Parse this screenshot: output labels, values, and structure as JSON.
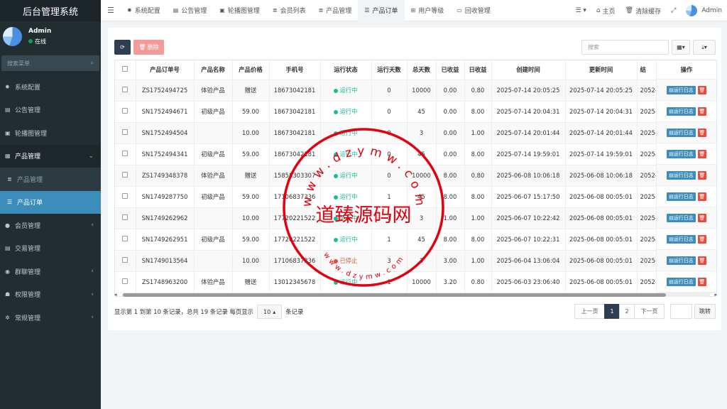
{
  "app": {
    "title": "后台管理系统"
  },
  "user": {
    "name": "Admin",
    "status": "在线"
  },
  "sidebar": {
    "search_placeholder": "搜索菜单",
    "items": [
      {
        "label": "系统配置",
        "icon": "gear-icon"
      },
      {
        "label": "公告管理",
        "icon": "file-icon"
      },
      {
        "label": "轮播图管理",
        "icon": "image-icon"
      },
      {
        "label": "产品管理",
        "icon": "grid-icon"
      },
      {
        "label": "产品管理",
        "icon": "list-icon"
      },
      {
        "label": "产品订单",
        "icon": "menu-icon"
      },
      {
        "label": "会员管理",
        "icon": "user-icon"
      },
      {
        "label": "交易管理",
        "icon": "list-icon"
      },
      {
        "label": "群聊管理",
        "icon": "chat-icon"
      },
      {
        "label": "权限管理",
        "icon": "group-icon"
      },
      {
        "label": "常规管理",
        "icon": "cogs-icon"
      }
    ]
  },
  "topbar": {
    "tabs": [
      {
        "label": "系统配置"
      },
      {
        "label": "公告管理"
      },
      {
        "label": "轮播图管理"
      },
      {
        "label": "会员列表"
      },
      {
        "label": "产品管理"
      },
      {
        "label": "产品订单"
      },
      {
        "label": "用户等级"
      },
      {
        "label": "回收管理"
      }
    ],
    "home": "主页",
    "clear_cache": "清除缓存",
    "user": "Admin"
  },
  "toolbar": {
    "delete_label": "删除",
    "search_placeholder": "搜索"
  },
  "table": {
    "headers": [
      "产品订单号",
      "产品名称",
      "产品价格",
      "手机号",
      "运行状态",
      "运行天数",
      "总天数",
      "已收益",
      "日收益",
      "创建时间",
      "更新时间",
      "结"
    ],
    "op_header": "操作",
    "op_log_label": "运行日志",
    "rows": [
      [
        "ZS1752494725",
        "体验产品",
        "赠送",
        "18673042181",
        "运行中",
        "0",
        "10000",
        "0.00",
        "0.80",
        "2025-07-14 20:05:25",
        "2025-07-14 20:05:25",
        "2052-1"
      ],
      [
        "SN1752494671",
        "初级产品",
        "59.00",
        "18673042181",
        "运行中",
        "0",
        "45",
        "0.00",
        "8.00",
        "2025-07-14 20:04:31",
        "2025-07-14 20:04:31",
        "2025-0"
      ],
      [
        "SN1752494504",
        "",
        "10.00",
        "18673042181",
        "运行中",
        "0",
        "3",
        "0.00",
        "1.00",
        "2025-07-14 20:01:44",
        "2025-07-14 20:01:44",
        "2025-0"
      ],
      [
        "SN1752494341",
        "初级产品",
        "59.00",
        "18673042181",
        "运行中",
        "0",
        "45",
        "0.00",
        "8.00",
        "2025-07-14 19:59:01",
        "2025-07-14 19:59:01",
        "2025-0"
      ],
      [
        "ZS1749348378",
        "体验产品",
        "赠送",
        "15858303307",
        "运行中",
        "0",
        "10000",
        "8.00",
        "0.80",
        "2025-06-08 10:06:18",
        "2025-06-08 10:06:18",
        "2052-1"
      ],
      [
        "SN1749287750",
        "初级产品",
        "59.00",
        "17106837336",
        "运行中",
        "1",
        "45",
        "8.00",
        "8.00",
        "2025-06-07 15:17:50",
        "2025-06-08 00:05:01",
        "2025-0"
      ],
      [
        "SN1749262962",
        "",
        "10.00",
        "17720221522",
        "运行中",
        "1",
        "3",
        "1.00",
        "1.00",
        "2025-06-07 10:22:42",
        "2025-06-08 00:05:01",
        "2025-0"
      ],
      [
        "SN1749262951",
        "初级产品",
        "59.00",
        "17720221522",
        "运行中",
        "1",
        "45",
        "8.00",
        "8.00",
        "2025-06-07 10:22:31",
        "2025-06-08 00:05:01",
        "2025-0"
      ],
      [
        "SN1749013564",
        "",
        "10.00",
        "17106837336",
        "已停止",
        "3",
        "3",
        "3.00",
        "1.00",
        "2025-06-04 13:06:04",
        "2025-06-08 00:05:01",
        "2025-0"
      ],
      [
        "ZS1748963200",
        "体验产品",
        "赠送",
        "13012345678",
        "运行中",
        "1",
        "10000",
        "3.20",
        "0.80",
        "2025-06-03 23:06:40",
        "2025-06-08 00:05:01",
        "2052-1"
      ]
    ]
  },
  "pagination": {
    "info_prefix": "显示第 1 到第 10 条记录，总共 19 条记录 每页显示",
    "page_size": "10",
    "info_suffix": "条记录",
    "prev": "上一页",
    "pages": [
      "1",
      "2"
    ],
    "next": "下一页",
    "jump": "跳转"
  },
  "watermark": {
    "text": "道臻源码网",
    "url_top": "www.dzymw.com",
    "url_bottom": "www.dzymw.com"
  },
  "colors": {
    "sidebar_bg": "#222d32",
    "active": "#3c8dbc",
    "running": "#18bc9c",
    "stopped": "#e74c3c",
    "watermark": "#e3000f"
  }
}
